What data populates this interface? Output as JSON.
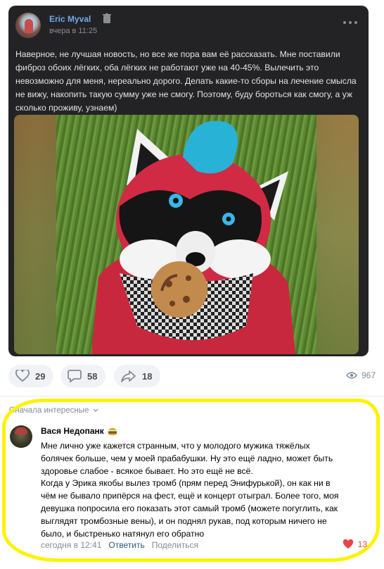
{
  "post": {
    "author": "Eric Myval",
    "time": "вчера в 11:25",
    "text": "Наверное, не лучшая новость, но все же пора вам её рассказать. Мне поставили фиброз обоих лёгких, оба лёгких не работают уже на 40-45%. Вылечить это невозможно для меня, нереально дорого. Делать какие-то сборы на лечение смысла не вижу, накопить такую сумму уже не смогу. Поэтому, буду бороться как смогу, а уж сколько проживу, узнаем)",
    "photo_icon": "fursuit-raccoon-photo"
  },
  "reactions": {
    "likes": "29",
    "comments": "58",
    "shares": "18",
    "views": "967"
  },
  "comments_section": {
    "sort_label": "Сначала интересные"
  },
  "comment": {
    "author": "Вася Недопанк",
    "text_lines": [
      "Мне лично уже кажется странным, что у молодого мужика тяжёлых",
      "болячек больше, чем у моей прабабушки. Ну это ещё ладно, может быть",
      "здоровье слабое - всякое бывает. Но это ещё не всё.",
      "Когда у Эрика якобы вылез тромб (прям перед Энифурькой), он как ни в",
      "чём не бывало припёрся на фест, ещё и концерт отыграл. Более того, моя",
      "девушка попросила его показать этот самый тромб (можете погуглить, как",
      "выглядят тромбозные вены), и он поднял рукав, под которым ничего не",
      "было, и быстренько натянул его обратно"
    ],
    "time": "сегодня в 12:41",
    "reply_label": "Ответить",
    "share_label": "Поделиться",
    "likes": "13"
  },
  "colors": {
    "link_blue": "#71aaeb",
    "like_red": "#e64646",
    "highlight_yellow": "#fef200"
  }
}
